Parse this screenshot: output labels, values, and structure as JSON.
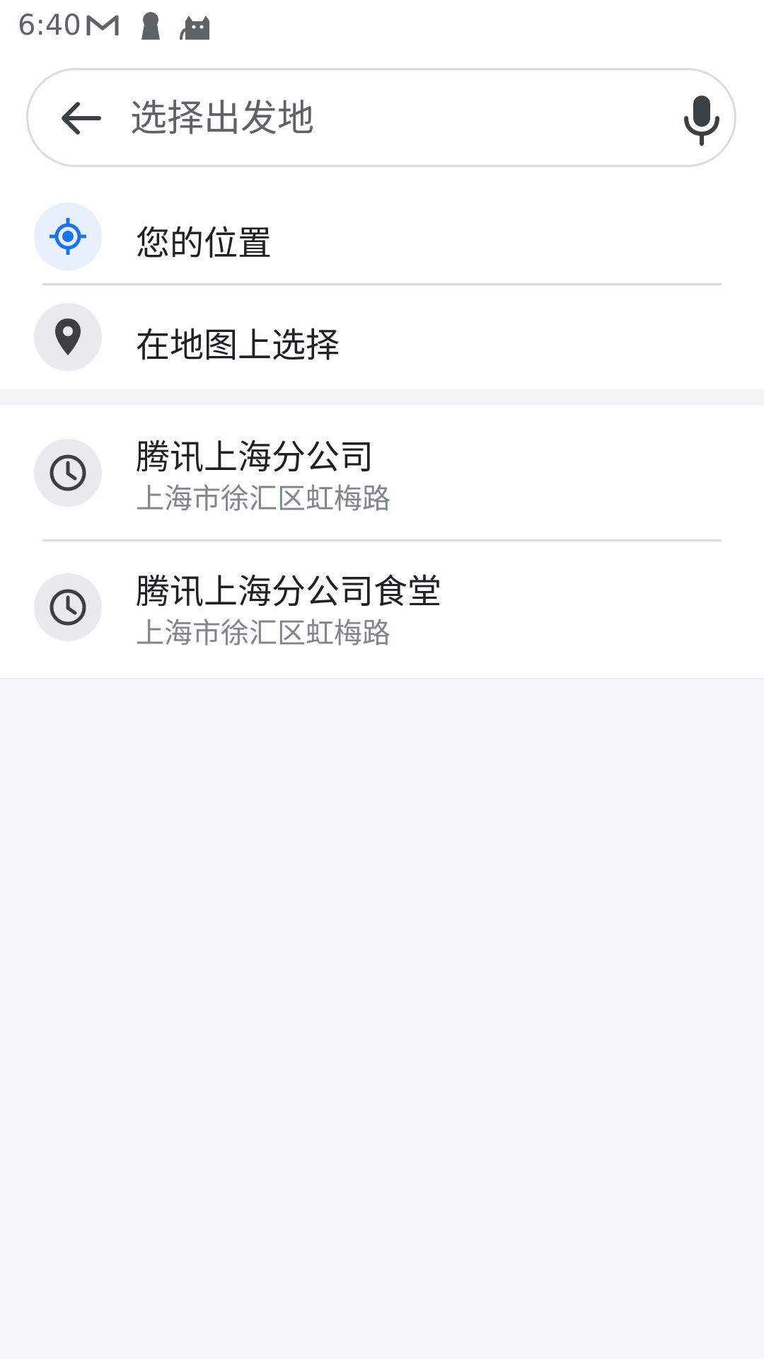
{
  "status_bar": {
    "time": "6:40",
    "icons": [
      "gmail-icon",
      "keyhole-icon",
      "cat-icon"
    ]
  },
  "search": {
    "placeholder": "选择出发地",
    "value": "",
    "back_icon": "arrow-back-icon",
    "mic_icon": "mic-icon"
  },
  "quick_options": [
    {
      "label": "您的位置",
      "icon": "my-location-icon",
      "accent": "#1a73e8"
    },
    {
      "label": "在地图上选择",
      "icon": "map-pin-icon"
    }
  ],
  "recent_places": [
    {
      "title": "腾讯上海分公司",
      "address": "上海市徐汇区虹梅路",
      "icon": "history-clock-icon"
    },
    {
      "title": "腾讯上海分公司食堂",
      "address": "上海市徐汇区虹梅路",
      "icon": "history-clock-icon"
    }
  ]
}
